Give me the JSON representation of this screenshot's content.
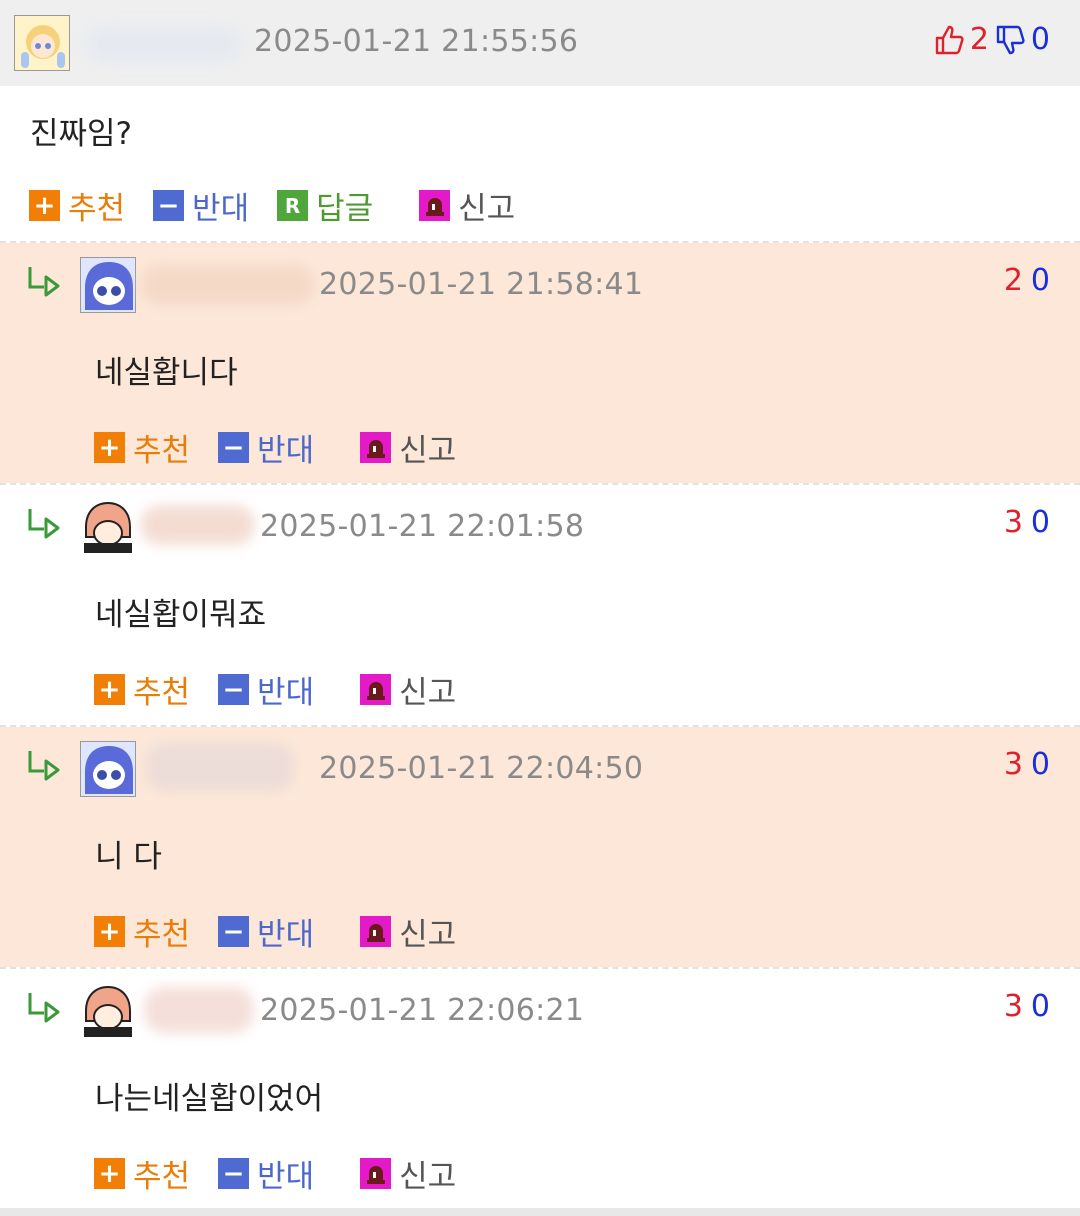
{
  "post": {
    "timestamp": "2025-01-21 21:55:56",
    "up": "2",
    "down": "0",
    "text": "진짜임?",
    "actions": {
      "recommend": "추천",
      "oppose": "반대",
      "reply": "답글",
      "report": "신고",
      "reply_badge": "R"
    }
  },
  "replies": [
    {
      "timestamp": "2025-01-21 21:58:41",
      "up": "2",
      "down": "0",
      "text": "네실홥니다"
    },
    {
      "timestamp": "2025-01-21 22:01:58",
      "up": "3",
      "down": "0",
      "text": "네실홥이뭐죠"
    },
    {
      "timestamp": "2025-01-21 22:04:50",
      "up": "3",
      "down": "0",
      "text": "니 다"
    },
    {
      "timestamp": "2025-01-21 22:06:21",
      "up": "3",
      "down": "0",
      "text": "나는네실홥이었어"
    }
  ],
  "reply_actions": {
    "recommend": "추천",
    "oppose": "반대",
    "report": "신고"
  },
  "colors": {
    "up": "#e0202a",
    "down": "#1a2fd8",
    "recommend": "#f27f05",
    "oppose": "#4f6ad1",
    "reply": "#4fa63a",
    "report": "#e419c8",
    "highlight_row": "#fce7d8"
  },
  "icons": {
    "thumbs_up": "thumbs-up-icon",
    "thumbs_down": "thumbs-down-icon",
    "reply_arrow": "reply-arrow-icon",
    "siren": "siren-icon"
  }
}
